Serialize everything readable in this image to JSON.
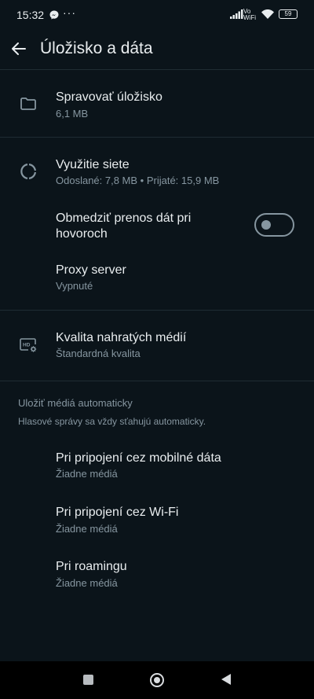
{
  "status_bar": {
    "time": "15:32",
    "notification_icons": [
      "messenger-icon",
      "more-dots-icon"
    ],
    "network_label": "Vo WiFi",
    "battery": "59"
  },
  "header": {
    "title": "Úložisko a dáta",
    "back_icon": "arrow-left-icon"
  },
  "storage": {
    "title": "Spravovať úložisko",
    "subtitle": "6,1 MB",
    "icon": "folder-icon"
  },
  "network": {
    "title": "Využitie siete",
    "subtitle": "Odoslané: 7,8 MB • Prijaté: 15,9 MB",
    "icon": "data-usage-icon"
  },
  "limit_calls": {
    "title_line1": "Obmedziť prenos dát pri",
    "title_line2": "hovoroch",
    "enabled": false
  },
  "proxy": {
    "title": "Proxy server",
    "subtitle": "Vypnuté"
  },
  "media_quality": {
    "title": "Kvalita nahratých médií",
    "subtitle": "Štandardná kvalita",
    "icon": "hd-settings-icon"
  },
  "auto_download": {
    "header": "Uložiť médiá automaticky",
    "note": "Hlasové správy sa vždy sťahujú automaticky.",
    "items": [
      {
        "title": "Pri pripojení cez mobilné dáta",
        "subtitle": "Žiadne médiá"
      },
      {
        "title": "Pri pripojení cez Wi-Fi",
        "subtitle": "Žiadne médiá"
      },
      {
        "title": "Pri roamingu",
        "subtitle": "Žiadne médiá"
      }
    ]
  },
  "colors": {
    "background": "#0b141a",
    "primary_text": "#e9edef",
    "secondary_text": "#8696a0",
    "divider": "#1f2c33"
  }
}
